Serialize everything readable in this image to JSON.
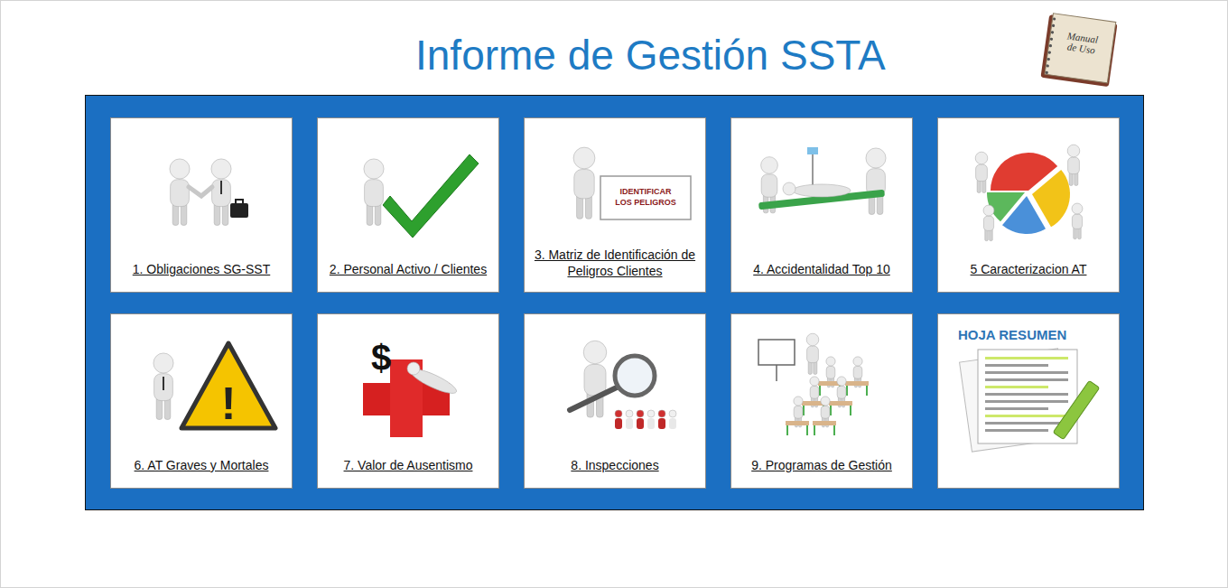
{
  "title": "Informe de Gestión SSTA",
  "manual": {
    "lines": [
      "Manual",
      "de Uso"
    ]
  },
  "cards": [
    {
      "label": "1. Obligaciones SG-SST",
      "kind": "handshake"
    },
    {
      "label": "2. Personal Activo / Clientes",
      "kind": "check"
    },
    {
      "label": "3. Matriz de Identificación de Peligros Clientes",
      "kind": "sign",
      "sign": [
        "IDENTIFICAR",
        "LOS PELIGROS"
      ]
    },
    {
      "label": "4. Accidentalidad Top 10",
      "kind": "stretcher"
    },
    {
      "label": "5 Caracterizacion AT",
      "kind": "pie"
    },
    {
      "label": "6. AT Graves y Mortales",
      "kind": "warning",
      "symbol": "!"
    },
    {
      "label": "7. Valor de Ausentismo",
      "kind": "cost",
      "symbol": "$"
    },
    {
      "label": "8. Inspecciones",
      "kind": "inspect"
    },
    {
      "label": "9. Programas de Gestión",
      "kind": "training"
    },
    {
      "label": "HOJA RESUMEN",
      "kind": "summary"
    }
  ]
}
